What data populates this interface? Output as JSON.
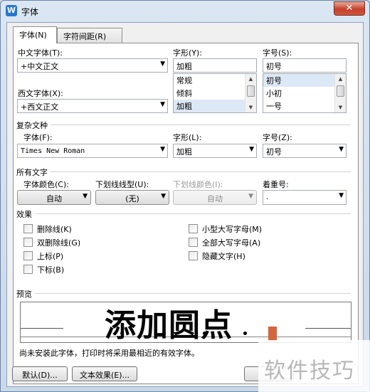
{
  "window": {
    "title": "字体",
    "app_icon": "W",
    "close_label": "✕"
  },
  "tabs": [
    {
      "label": "字体(N)"
    },
    {
      "label": "字符间距(R)"
    }
  ],
  "chinese_font": {
    "label": "中文字体(T):",
    "value": "+中文正文"
  },
  "western_font": {
    "label": "西文字体(X):",
    "value": "+西文正文"
  },
  "font_style": {
    "label": "字形(Y):",
    "value": "加粗",
    "options": [
      "常规",
      "倾斜",
      "加粗"
    ]
  },
  "font_size": {
    "label": "字号(S):",
    "value": "初号",
    "options": [
      "初号",
      "小初",
      "一号"
    ]
  },
  "complex": {
    "section": "复杂文种",
    "font_label": "字体(F):",
    "font_value": "Times New Roman",
    "style_label": "字形(L):",
    "style_value": "加粗",
    "size_label": "字号(Z):",
    "size_value": "初号"
  },
  "all_text": {
    "section": "所有文字",
    "font_color_label": "字体颜色(C):",
    "font_color_value": "自动",
    "underline_type_label": "下划线线型(U):",
    "underline_type_value": "(无)",
    "underline_color_label": "下划线颜色(I):",
    "underline_color_value": "自动",
    "emphasis_label": "着重号:",
    "emphasis_value": "."
  },
  "effects": {
    "section": "效果",
    "items": [
      "删除线(K)",
      "双删除线(G)",
      "上标(P)",
      "下标(B)",
      "小型大写字母(M)",
      "全部大写字母(A)",
      "隐藏文字(H)"
    ]
  },
  "preview": {
    "section": "预览",
    "text": "添加圆点",
    "note": "尚未安装此字体，打印时将采用最相近的有效字体。"
  },
  "buttons": {
    "default": "默认(D)...",
    "text_effects": "文本效果(E)..."
  },
  "watermark": "软件技巧",
  "colors": {
    "cursor": "#d2663f",
    "selection": "#dde8f6",
    "close": "#c4402a"
  }
}
